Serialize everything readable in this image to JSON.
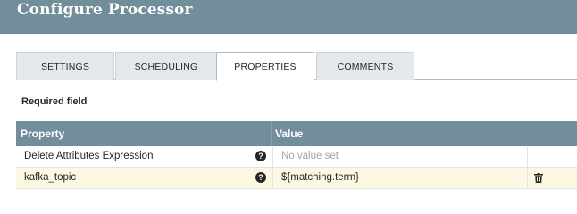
{
  "header": {
    "title": "Configure Processor"
  },
  "tabs": [
    {
      "label": "SETTINGS"
    },
    {
      "label": "SCHEDULING"
    },
    {
      "label": "PROPERTIES"
    },
    {
      "label": "COMMENTS"
    }
  ],
  "active_tab": "PROPERTIES",
  "required_field_label": "Required field",
  "table": {
    "columns": {
      "property": "Property",
      "value": "Value"
    },
    "rows": [
      {
        "property": "Delete Attributes Expression",
        "value": "No value set",
        "value_is_placeholder": true,
        "has_delete": false
      },
      {
        "property": "kafka_topic",
        "value": "${matching.term}",
        "value_is_placeholder": false,
        "has_delete": true
      }
    ]
  },
  "icons": {
    "help": "help-icon",
    "delete": "trash-icon"
  },
  "colors": {
    "header_bg": "#728e9b",
    "active_tab_bg": "#ffffff",
    "inactive_tab_bg": "#e3e8eb",
    "highlight_row_bg": "#fdf8e2"
  }
}
